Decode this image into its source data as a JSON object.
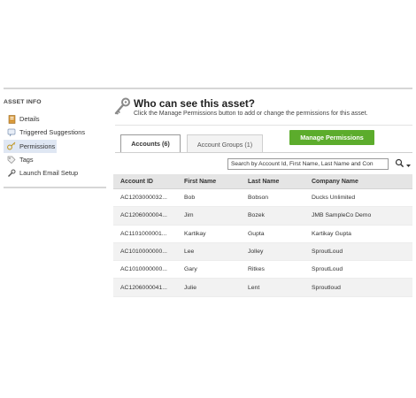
{
  "sidebar": {
    "header": "ASSET INFO",
    "items": [
      {
        "label": "Details",
        "icon": "details-icon"
      },
      {
        "label": "Triggered Suggestions",
        "icon": "suggestion-icon"
      },
      {
        "label": "Permissions",
        "icon": "permissions-icon",
        "active": true
      },
      {
        "label": "Tags",
        "icon": "tag-icon"
      },
      {
        "label": "Launch Email Setup",
        "icon": "wrench-icon"
      }
    ]
  },
  "main": {
    "title": "Who can see this asset?",
    "subtitle": "Click the Manage Permissions button to add or change the permissions for this asset.",
    "tabs": [
      "Accounts (6)",
      "Account Groups (1)"
    ],
    "manage_button": "Manage Permissions",
    "search_placeholder": "Search by Account Id, First Name, Last Name and Con",
    "table": {
      "headers": [
        "Account ID",
        "First Name",
        "Last Name",
        "Company Name"
      ],
      "rows": [
        [
          "AC1203000032...",
          "Bob",
          "Bobson",
          "Ducks Unlimited"
        ],
        [
          "AC1206000004...",
          "Jim",
          "Bozek",
          "JMB SampleCo Demo"
        ],
        [
          "AC1101000001...",
          "Kartikay",
          "Gupta",
          "Kartikay Gupta"
        ],
        [
          "AC1010000000...",
          "Lee",
          "Jolley",
          "SproutLoud"
        ],
        [
          "AC1010000000...",
          "Gary",
          "Ritkes",
          "SproutLoud"
        ],
        [
          "AC1206000041...",
          "Julie",
          "Lent",
          "Sproutloud"
        ]
      ]
    }
  },
  "colors": {
    "accent_green": "#5cac2c",
    "active_bg": "#dfe7f3",
    "header_bg": "#e5e5e5"
  }
}
